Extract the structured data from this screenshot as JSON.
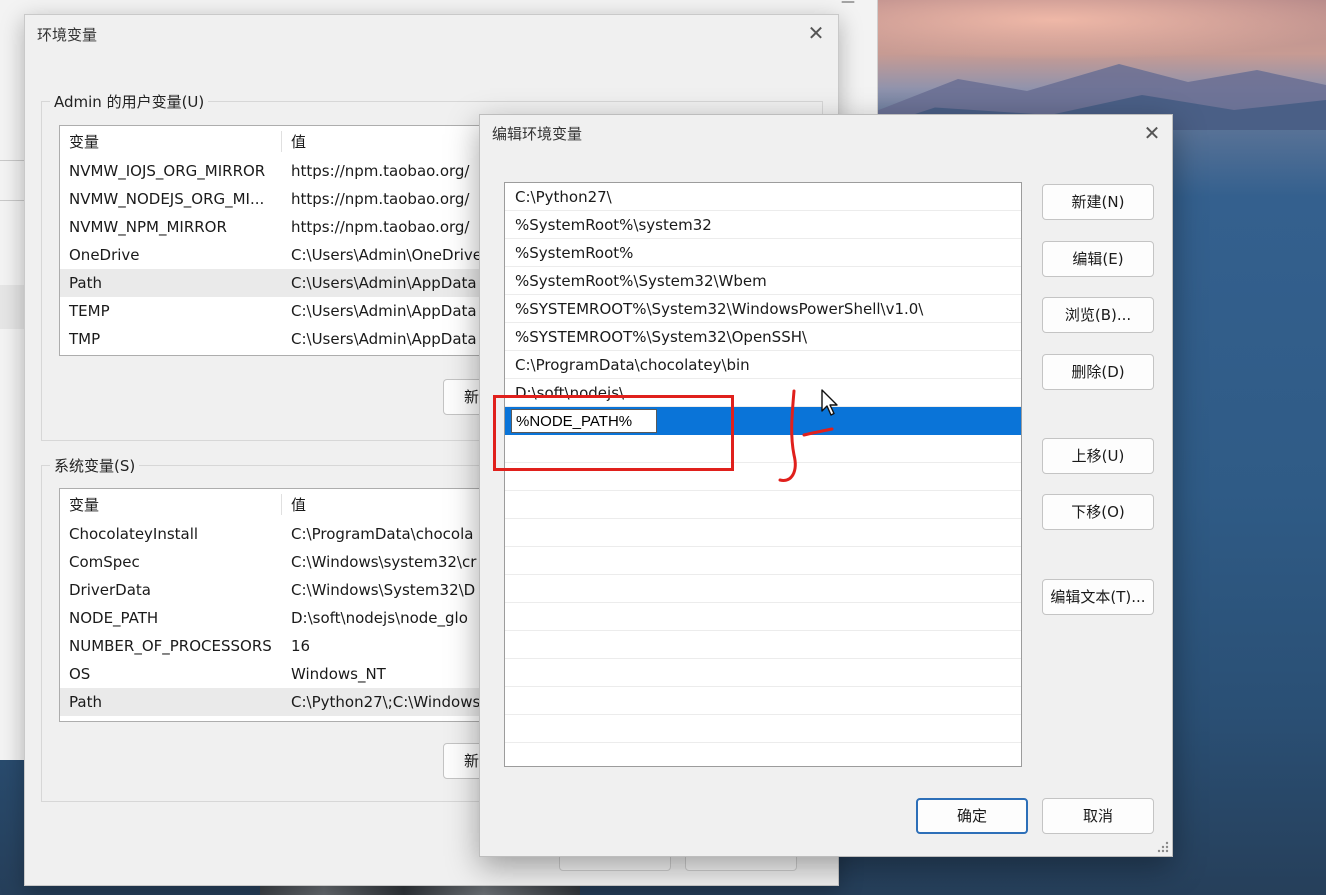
{
  "env_dialog": {
    "title": "环境变量",
    "user_group_label": "Admin 的用户变量(U)",
    "system_group_label": "系统变量(S)",
    "col_var": "变量",
    "col_val": "值",
    "user_vars": [
      {
        "name": "NVMW_IOJS_ORG_MIRROR",
        "value": "https://npm.taobao.org/"
      },
      {
        "name": "NVMW_NODEJS_ORG_MI...",
        "value": "https://npm.taobao.org/"
      },
      {
        "name": "NVMW_NPM_MIRROR",
        "value": "https://npm.taobao.org/"
      },
      {
        "name": "OneDrive",
        "value": "C:\\Users\\Admin\\OneDrive"
      },
      {
        "name": "Path",
        "value": "C:\\Users\\Admin\\AppData"
      },
      {
        "name": "TEMP",
        "value": "C:\\Users\\Admin\\AppData"
      },
      {
        "name": "TMP",
        "value": "C:\\Users\\Admin\\AppData"
      }
    ],
    "system_vars": [
      {
        "name": "ChocolateyInstall",
        "value": "C:\\ProgramData\\chocola"
      },
      {
        "name": "ComSpec",
        "value": "C:\\Windows\\system32\\cr"
      },
      {
        "name": "DriverData",
        "value": "C:\\Windows\\System32\\D"
      },
      {
        "name": "NODE_PATH",
        "value": "D:\\soft\\nodejs\\node_glo"
      },
      {
        "name": "NUMBER_OF_PROCESSORS",
        "value": "16"
      },
      {
        "name": "OS",
        "value": "Windows_NT"
      },
      {
        "name": "Path",
        "value": "C:\\Python27\\;C:\\Windows"
      }
    ],
    "partial_new_label": "新"
  },
  "edit_dialog": {
    "title": "编辑环境变量",
    "paths": [
      "C:\\Python27\\",
      "%SystemRoot%\\system32",
      "%SystemRoot%",
      "%SystemRoot%\\System32\\Wbem",
      "%SYSTEMROOT%\\System32\\WindowsPowerShell\\v1.0\\",
      "%SYSTEMROOT%\\System32\\OpenSSH\\",
      "C:\\ProgramData\\chocolatey\\bin",
      "D:\\soft\\nodejs\\"
    ],
    "editing_value": "%NODE_PATH%",
    "buttons": {
      "new": "新建(N)",
      "edit": "编辑(E)",
      "browse": "浏览(B)...",
      "delete": "删除(D)",
      "move_up": "上移(U)",
      "move_down": "下移(O)",
      "edit_text": "编辑文本(T)...",
      "ok": "确定",
      "cancel": "取消"
    }
  },
  "colors": {
    "selection": "#0a74d8",
    "annotation_red": "#e0201c"
  },
  "icons": [
    "close-icon",
    "mouse-cursor-icon",
    "resize-grip-icon"
  ]
}
